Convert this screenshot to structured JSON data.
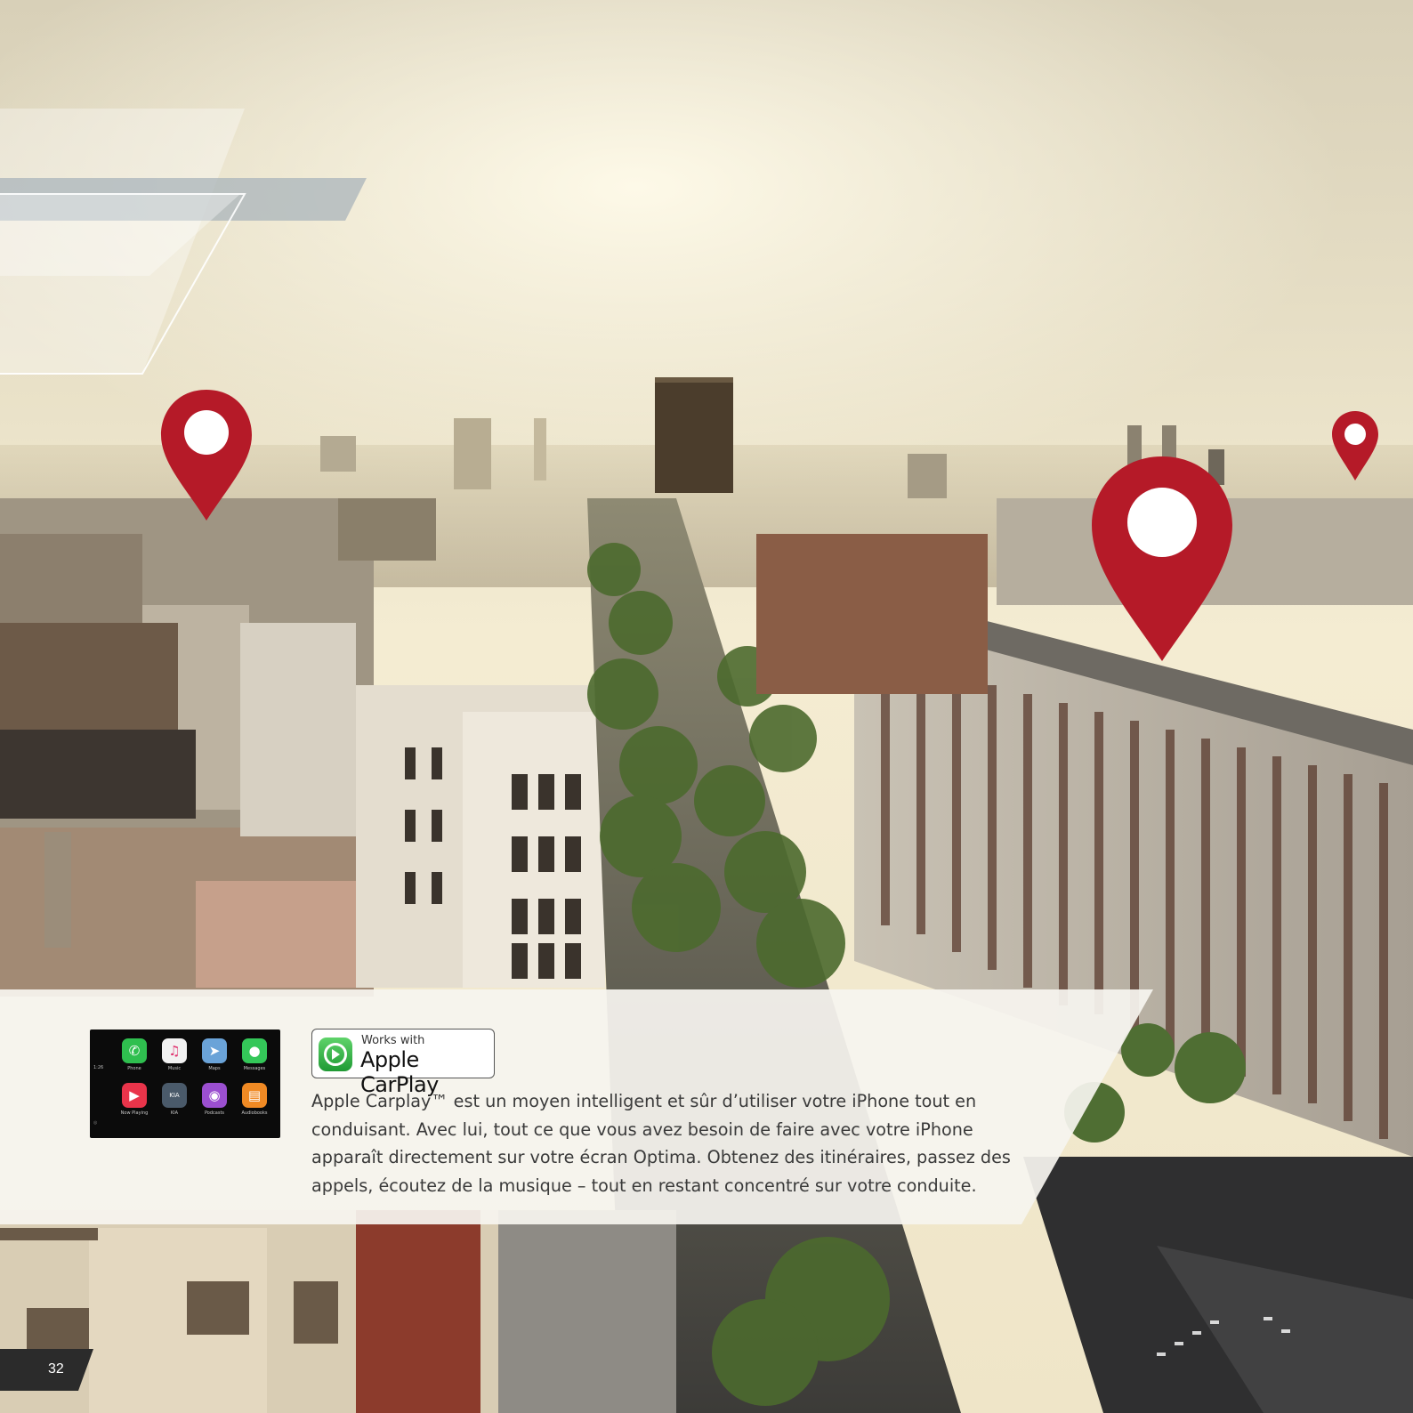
{
  "carplay_screen": {
    "time": "1:26",
    "apps": [
      {
        "label": "Phone",
        "icon": "phone-icon",
        "glyph": "✆",
        "color": "#2fbf4f"
      },
      {
        "label": "Music",
        "icon": "music-icon",
        "glyph": "♫",
        "color": "#f2f2f2"
      },
      {
        "label": "Maps",
        "icon": "maps-icon",
        "glyph": "➤",
        "color": "#6aa3d8"
      },
      {
        "label": "Messages",
        "icon": "messages-icon",
        "glyph": "●",
        "color": "#34c759"
      },
      {
        "label": "Now Playing",
        "icon": "now-playing-icon",
        "glyph": "▶",
        "color": "#e9344a"
      },
      {
        "label": "KIA",
        "icon": "kia-icon",
        "glyph": "KIA",
        "color": "#4a5a6a"
      },
      {
        "label": "Podcasts",
        "icon": "podcasts-icon",
        "glyph": "◉",
        "color": "#9b4fd0"
      },
      {
        "label": "Audiobooks",
        "icon": "audiobooks-icon",
        "glyph": "▤",
        "color": "#f08a24"
      }
    ]
  },
  "badge": {
    "line1": "Works with",
    "line2": "Apple CarPlay"
  },
  "body": {
    "text": "Apple Carplay™ est un moyen intelligent et sûr d’utiliser votre iPhone tout en conduisant. Avec lui, tout ce que vous avez besoin de faire avec votre iPhone apparaît directement sur votre écran Optima. Obtenez des itinéraires, passez des appels, écoutez de la musique – tout en restant concentré sur votre conduite."
  },
  "page": {
    "number": "32"
  },
  "colors": {
    "pin_red": "#b51a28",
    "panel_white": "#f6f4ef",
    "text_gray": "#3a3a3a"
  }
}
